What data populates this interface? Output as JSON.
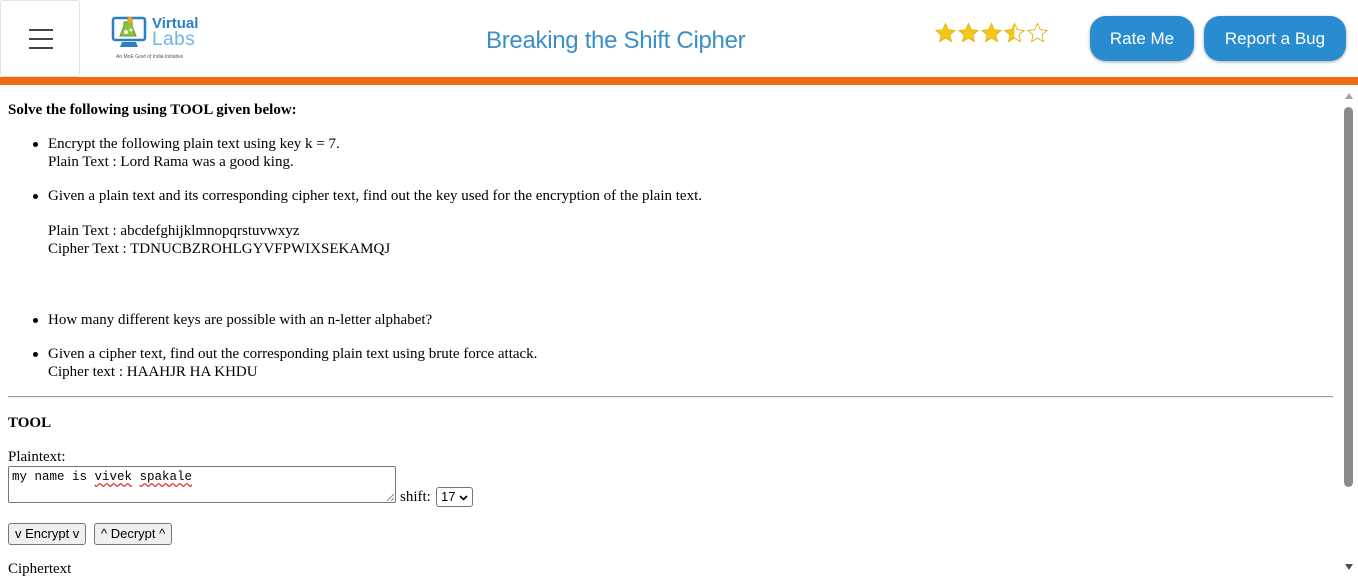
{
  "header": {
    "logo_line1": "Virtual",
    "logo_line2": "Labs",
    "logo_tagline": "An MoE Govt of India Initiative",
    "title": "Breaking the Shift Cipher",
    "rating": {
      "value": 3.5,
      "max": 5,
      "star_color": "#f5c518"
    },
    "rate_button": "Rate Me",
    "bug_button": "Report a Bug",
    "menu_icon": "hamburger-menu-icon",
    "accent_bar_color": "#ef6b10",
    "button_color": "#2a8cd0"
  },
  "instructions": {
    "heading": "Solve the following using TOOL given below:",
    "questions": [
      {
        "line1": "Encrypt the following plain text using key k = 7.",
        "line2": "Plain Text : Lord Rama was a good king."
      },
      {
        "line1": "Given a plain text and its corresponding cipher text, find out the key used for the encryption of the plain text.",
        "line2": "Plain Text : abcdefghijklmnopqrstuvwxyz",
        "line3": "Cipher Text : TDNUCBZROHLGYVFPWIXSEKAMQJ"
      },
      {
        "line1": "How many different keys are possible with an n-letter alphabet?"
      },
      {
        "line1": "Given a cipher text, find out the corresponding plain text using brute force attack.",
        "line2": "Cipher text : HAAHJR HA KHDU"
      }
    ]
  },
  "tool": {
    "heading": "TOOL",
    "plaintext_label": "Plaintext:",
    "plaintext_value_words": [
      "my name is ",
      "vivek",
      " ",
      "spakale"
    ],
    "shift_label": "shift:",
    "shift_value": "17",
    "encrypt_button": "v Encrypt v",
    "decrypt_button": "^ Decrypt ^",
    "ciphertext_label": "Ciphertext"
  }
}
